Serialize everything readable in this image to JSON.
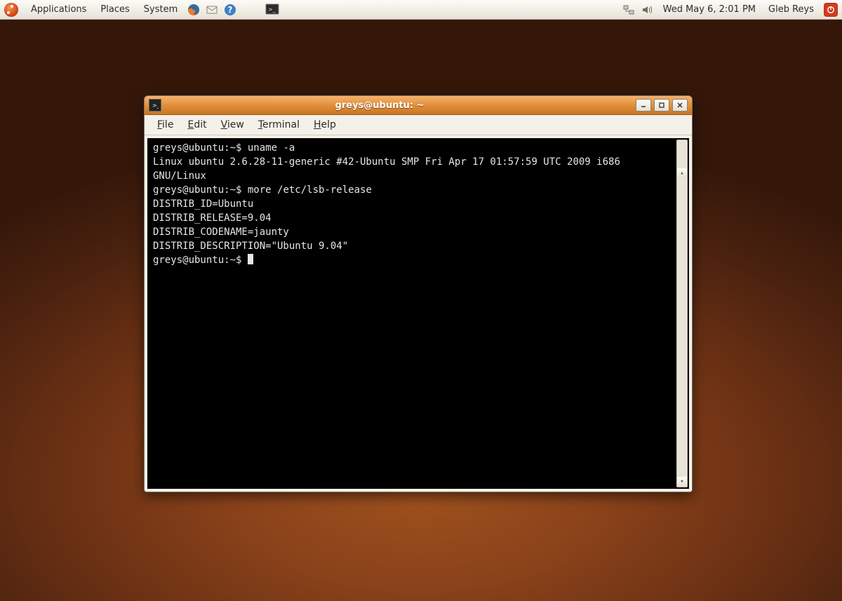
{
  "panel": {
    "menus": [
      "Applications",
      "Places",
      "System"
    ],
    "clock": "Wed May  6,  2:01 PM",
    "user": "Gleb Reys"
  },
  "window": {
    "title": "greys@ubuntu: ~",
    "menubar": {
      "file": {
        "u": "F",
        "rest": "ile"
      },
      "edit": {
        "u": "E",
        "rest": "dit"
      },
      "view": {
        "u": "V",
        "rest": "iew"
      },
      "terminal": {
        "u": "T",
        "rest": "erminal"
      },
      "help": {
        "u": "H",
        "rest": "elp"
      }
    }
  },
  "terminal": {
    "prompt": "greys@ubuntu:~$",
    "lines": {
      "cmd1": "uname -a",
      "out1": "Linux ubuntu 2.6.28-11-generic #42-Ubuntu SMP Fri Apr 17 01:57:59 UTC 2009 i686",
      "out1b": "GNU/Linux",
      "cmd2": "more /etc/lsb-release",
      "out2a": "DISTRIB_ID=Ubuntu",
      "out2b": "DISTRIB_RELEASE=9.04",
      "out2c": "DISTRIB_CODENAME=jaunty",
      "out2d": "DISTRIB_DESCRIPTION=\"Ubuntu 9.04\""
    }
  }
}
